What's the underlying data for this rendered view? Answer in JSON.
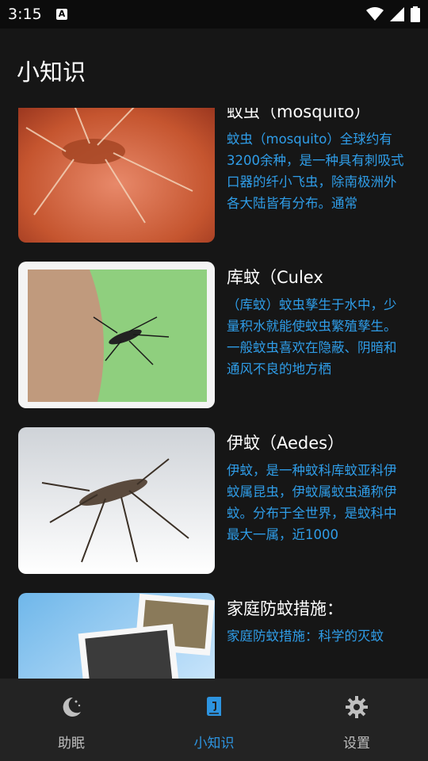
{
  "status_bar": {
    "time": "3:15",
    "notification_glyph": "A"
  },
  "header": {
    "title": "小知识"
  },
  "articles": [
    {
      "title": "蚊虫（mosquito）",
      "desc": "蚊虫（mosquito）全球约有3200余种，是一种具有刺吸式口器的纤小飞虫，除南极洲外各大陆皆有分布。通常",
      "image": "mosquito-on-skin"
    },
    {
      "title": "库蚊（Culex",
      "desc": "（库蚊）蚊虫孳生于水中，少量积水就能使蚊虫繁殖孳生。一般蚊虫喜欢在隐蔽、阴暗和通风不良的地方栖",
      "image": "mosquito-on-arm"
    },
    {
      "title": "伊蚊（Aedes）",
      "desc": "伊蚊，是一种蚊科库蚊亚科伊蚊属昆虫，伊蚊属蚊虫通称伊蚊。分布于全世界，是蚊科中最大一属，近1000",
      "image": "striped-mosquito"
    },
    {
      "title": "家庭防蚊措施：",
      "desc": "家庭防蚊措施：科学的灭蚊",
      "image": "household-photos"
    }
  ],
  "tabs": [
    {
      "label": "助眠",
      "icon": "moon-icon",
      "active": false
    },
    {
      "label": "小知识",
      "icon": "book-icon",
      "active": true
    },
    {
      "label": "设置",
      "icon": "gear-icon",
      "active": false
    }
  ],
  "colors": {
    "accent": "#2d94e0",
    "desc_text": "#2f9de8",
    "background": "#161616",
    "tab_bar": "#232323"
  }
}
